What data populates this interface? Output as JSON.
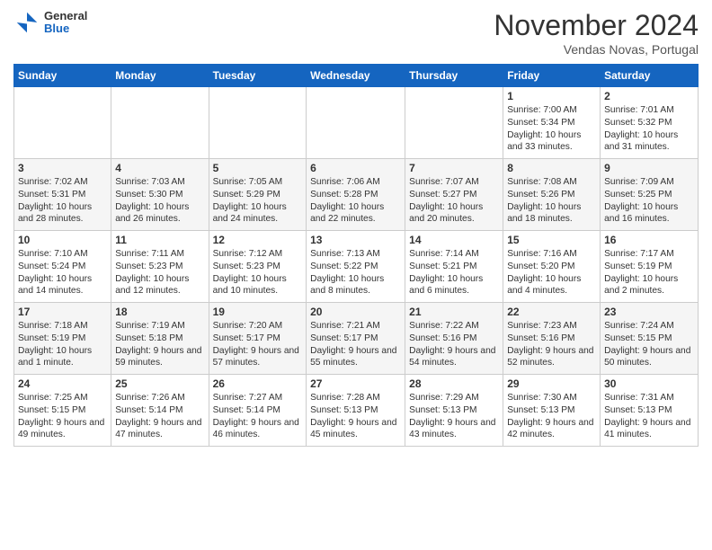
{
  "logo": {
    "general": "General",
    "blue": "Blue"
  },
  "header": {
    "month": "November 2024",
    "location": "Vendas Novas, Portugal"
  },
  "weekdays": [
    "Sunday",
    "Monday",
    "Tuesday",
    "Wednesday",
    "Thursday",
    "Friday",
    "Saturday"
  ],
  "weeks": [
    [
      {
        "day": "",
        "info": ""
      },
      {
        "day": "",
        "info": ""
      },
      {
        "day": "",
        "info": ""
      },
      {
        "day": "",
        "info": ""
      },
      {
        "day": "",
        "info": ""
      },
      {
        "day": "1",
        "info": "Sunrise: 7:00 AM\nSunset: 5:34 PM\nDaylight: 10 hours\nand 33 minutes."
      },
      {
        "day": "2",
        "info": "Sunrise: 7:01 AM\nSunset: 5:32 PM\nDaylight: 10 hours\nand 31 minutes."
      }
    ],
    [
      {
        "day": "3",
        "info": "Sunrise: 7:02 AM\nSunset: 5:31 PM\nDaylight: 10 hours\nand 28 minutes."
      },
      {
        "day": "4",
        "info": "Sunrise: 7:03 AM\nSunset: 5:30 PM\nDaylight: 10 hours\nand 26 minutes."
      },
      {
        "day": "5",
        "info": "Sunrise: 7:05 AM\nSunset: 5:29 PM\nDaylight: 10 hours\nand 24 minutes."
      },
      {
        "day": "6",
        "info": "Sunrise: 7:06 AM\nSunset: 5:28 PM\nDaylight: 10 hours\nand 22 minutes."
      },
      {
        "day": "7",
        "info": "Sunrise: 7:07 AM\nSunset: 5:27 PM\nDaylight: 10 hours\nand 20 minutes."
      },
      {
        "day": "8",
        "info": "Sunrise: 7:08 AM\nSunset: 5:26 PM\nDaylight: 10 hours\nand 18 minutes."
      },
      {
        "day": "9",
        "info": "Sunrise: 7:09 AM\nSunset: 5:25 PM\nDaylight: 10 hours\nand 16 minutes."
      }
    ],
    [
      {
        "day": "10",
        "info": "Sunrise: 7:10 AM\nSunset: 5:24 PM\nDaylight: 10 hours\nand 14 minutes."
      },
      {
        "day": "11",
        "info": "Sunrise: 7:11 AM\nSunset: 5:23 PM\nDaylight: 10 hours\nand 12 minutes."
      },
      {
        "day": "12",
        "info": "Sunrise: 7:12 AM\nSunset: 5:23 PM\nDaylight: 10 hours\nand 10 minutes."
      },
      {
        "day": "13",
        "info": "Sunrise: 7:13 AM\nSunset: 5:22 PM\nDaylight: 10 hours\nand 8 minutes."
      },
      {
        "day": "14",
        "info": "Sunrise: 7:14 AM\nSunset: 5:21 PM\nDaylight: 10 hours\nand 6 minutes."
      },
      {
        "day": "15",
        "info": "Sunrise: 7:16 AM\nSunset: 5:20 PM\nDaylight: 10 hours\nand 4 minutes."
      },
      {
        "day": "16",
        "info": "Sunrise: 7:17 AM\nSunset: 5:19 PM\nDaylight: 10 hours\nand 2 minutes."
      }
    ],
    [
      {
        "day": "17",
        "info": "Sunrise: 7:18 AM\nSunset: 5:19 PM\nDaylight: 10 hours\nand 1 minute."
      },
      {
        "day": "18",
        "info": "Sunrise: 7:19 AM\nSunset: 5:18 PM\nDaylight: 9 hours\nand 59 minutes."
      },
      {
        "day": "19",
        "info": "Sunrise: 7:20 AM\nSunset: 5:17 PM\nDaylight: 9 hours\nand 57 minutes."
      },
      {
        "day": "20",
        "info": "Sunrise: 7:21 AM\nSunset: 5:17 PM\nDaylight: 9 hours\nand 55 minutes."
      },
      {
        "day": "21",
        "info": "Sunrise: 7:22 AM\nSunset: 5:16 PM\nDaylight: 9 hours\nand 54 minutes."
      },
      {
        "day": "22",
        "info": "Sunrise: 7:23 AM\nSunset: 5:16 PM\nDaylight: 9 hours\nand 52 minutes."
      },
      {
        "day": "23",
        "info": "Sunrise: 7:24 AM\nSunset: 5:15 PM\nDaylight: 9 hours\nand 50 minutes."
      }
    ],
    [
      {
        "day": "24",
        "info": "Sunrise: 7:25 AM\nSunset: 5:15 PM\nDaylight: 9 hours\nand 49 minutes."
      },
      {
        "day": "25",
        "info": "Sunrise: 7:26 AM\nSunset: 5:14 PM\nDaylight: 9 hours\nand 47 minutes."
      },
      {
        "day": "26",
        "info": "Sunrise: 7:27 AM\nSunset: 5:14 PM\nDaylight: 9 hours\nand 46 minutes."
      },
      {
        "day": "27",
        "info": "Sunrise: 7:28 AM\nSunset: 5:13 PM\nDaylight: 9 hours\nand 45 minutes."
      },
      {
        "day": "28",
        "info": "Sunrise: 7:29 AM\nSunset: 5:13 PM\nDaylight: 9 hours\nand 43 minutes."
      },
      {
        "day": "29",
        "info": "Sunrise: 7:30 AM\nSunset: 5:13 PM\nDaylight: 9 hours\nand 42 minutes."
      },
      {
        "day": "30",
        "info": "Sunrise: 7:31 AM\nSunset: 5:13 PM\nDaylight: 9 hours\nand 41 minutes."
      }
    ]
  ]
}
